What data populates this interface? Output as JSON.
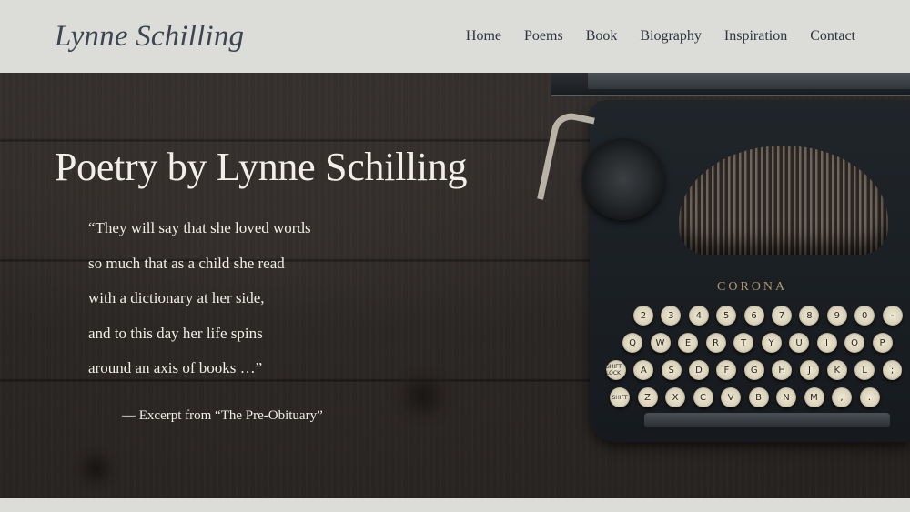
{
  "header": {
    "site_title": "Lynne Schilling",
    "nav": [
      {
        "label": "Home"
      },
      {
        "label": "Poems"
      },
      {
        "label": "Book"
      },
      {
        "label": "Biography"
      },
      {
        "label": "Inspiration"
      },
      {
        "label": "Contact"
      }
    ]
  },
  "hero": {
    "heading": "Poetry by Lynne Schilling",
    "quote_lines": [
      "“They will say that she loved words",
      "so much that as a child she read",
      "with a dictionary at her side,",
      "and to this day her life spins",
      "around an axis of books …”"
    ],
    "attribution": "— Excerpt from “The Pre-Obituary”"
  },
  "typewriter": {
    "brand": "CORONA",
    "key_rows": [
      [
        "2",
        "3",
        "4",
        "5",
        "6",
        "7",
        "8",
        "9",
        "0",
        "-"
      ],
      [
        "Q",
        "W",
        "E",
        "R",
        "T",
        "Y",
        "U",
        "I",
        "O",
        "P"
      ],
      [
        "SHIFT LOCK",
        "A",
        "S",
        "D",
        "F",
        "G",
        "H",
        "J",
        "K",
        "L",
        ";"
      ],
      [
        "SHIFT",
        "Z",
        "X",
        "C",
        "V",
        "B",
        "N",
        "M",
        ",",
        "."
      ]
    ]
  },
  "colors": {
    "header_bg": "#dcdcd8",
    "title_color": "#3c4652",
    "nav_color": "#2f3540",
    "hero_text": "#f2efea"
  }
}
